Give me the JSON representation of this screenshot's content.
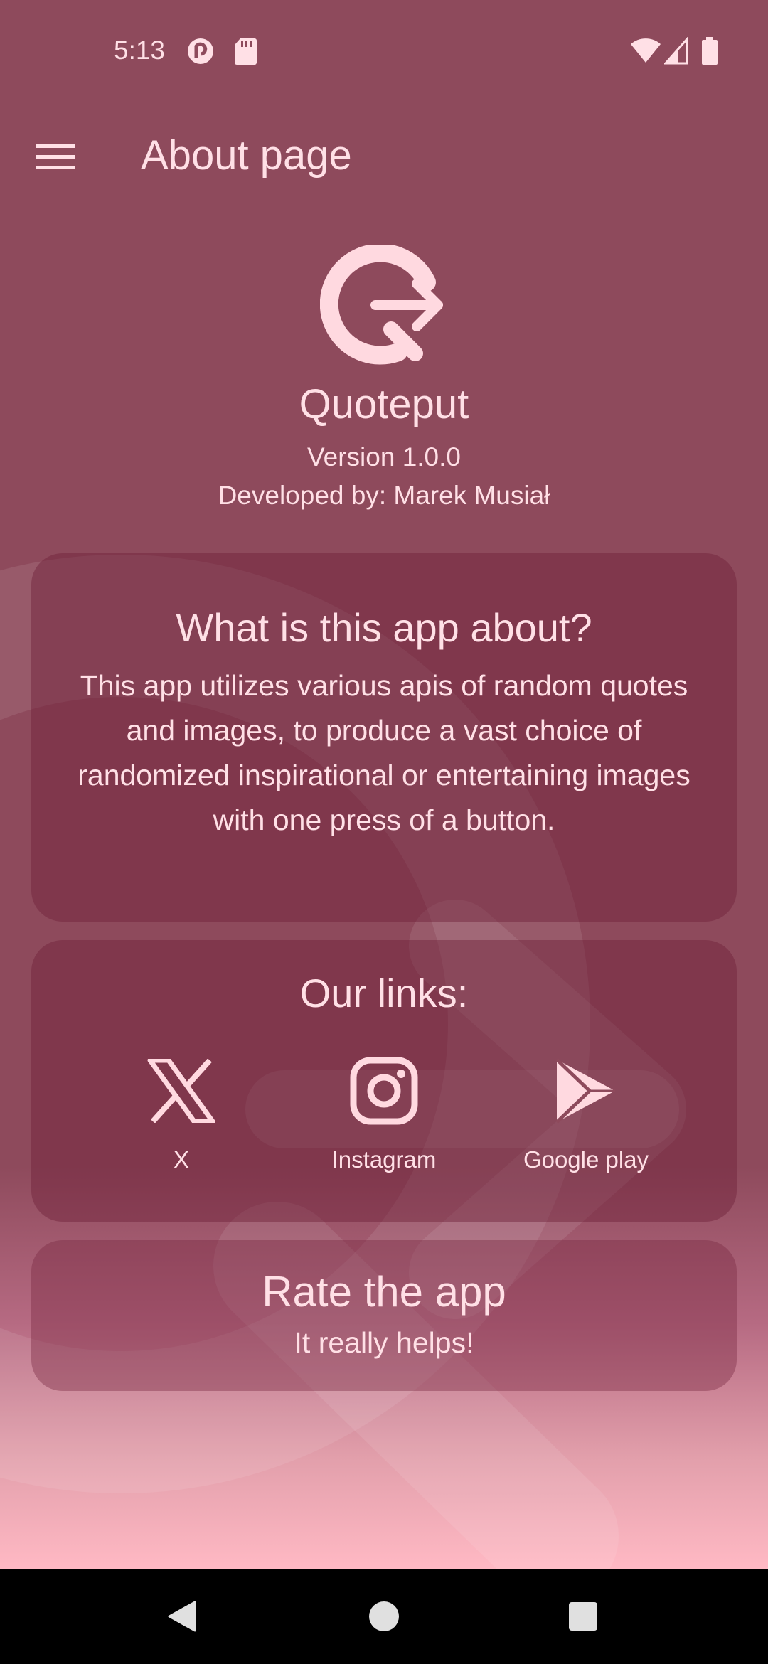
{
  "status_bar": {
    "time": "5:13",
    "left_icons": [
      "pocket-casts-icon",
      "sd-card-icon"
    ],
    "right_icons": [
      "wifi-icon",
      "cell-signal-icon",
      "battery-icon"
    ]
  },
  "app_bar": {
    "menu_icon": "hamburger-menu-icon",
    "title": "About page"
  },
  "header": {
    "logo_icon": "quoteput-logo-icon",
    "app_name": "Quoteput",
    "version": "Version 1.0.0",
    "developer": "Developed by: Marek Musiał"
  },
  "about_card": {
    "heading": "What is this app about?",
    "body": "This app utilizes various apis of random quotes and images, to produce a vast choice of randomized inspirational or entertaining images with one press of a button."
  },
  "links_card": {
    "heading": "Our links:",
    "links": [
      {
        "label": "X",
        "icon": "x-logo-icon"
      },
      {
        "label": "Instagram",
        "icon": "instagram-icon"
      },
      {
        "label": "Google play",
        "icon": "google-play-icon"
      }
    ]
  },
  "rate_card": {
    "title": "Rate the app",
    "subtitle": "It really helps!"
  },
  "nav_bar": {
    "buttons": [
      "back-icon",
      "home-icon",
      "recents-icon"
    ]
  },
  "colors": {
    "background": "#8e4a5c",
    "background_bottom": "#ffb9c4",
    "card": "#7d3a4e",
    "text": "#ffd9e0",
    "nav_bar": "#000000"
  }
}
